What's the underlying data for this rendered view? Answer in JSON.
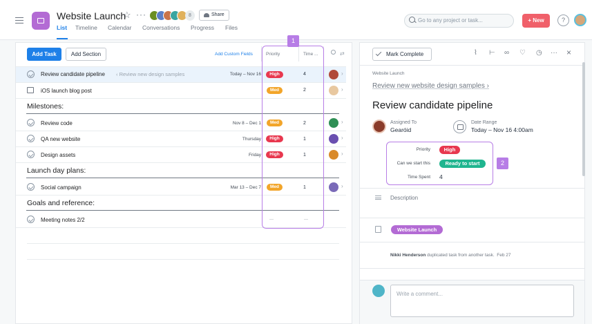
{
  "project": {
    "title": "Website Launch",
    "member_count": "8",
    "share_label": "Share",
    "icon": "project-list-icon",
    "brand_color": "#b36bd4"
  },
  "tabs": [
    "List",
    "Timeline",
    "Calendar",
    "Conversations",
    "Progress",
    "Files"
  ],
  "active_tab": "List",
  "search": {
    "placeholder": "Go to any project or task..."
  },
  "new_button": "+ New",
  "help_label": "?",
  "list": {
    "add_task": "Add Task",
    "add_section": "Add Section",
    "add_custom_fields": "Add Custom Fields",
    "columns": {
      "priority": "Priority",
      "time": "Time ..."
    },
    "tasks": [
      {
        "name": "Review candidate pipeline",
        "subtask_ref": "‹ Review new design samples",
        "date": "Today – Nov 16",
        "priority": "High",
        "time": "4",
        "selected": true
      },
      {
        "name": "iOS launch blog post",
        "date": "",
        "priority": "Med",
        "time": "2"
      }
    ],
    "sections": [
      {
        "title": "Milestones:",
        "tasks": [
          {
            "name": "Review code",
            "date": "Nov 8 – Dec 1",
            "priority": "Med",
            "time": "2"
          },
          {
            "name": "QA new website",
            "date": "Thursday",
            "priority": "High",
            "time": "1"
          },
          {
            "name": "Design assets",
            "date": "Friday",
            "priority": "High",
            "time": "1"
          }
        ]
      },
      {
        "title": "Launch day plans:",
        "tasks": [
          {
            "name": "Social campaign",
            "date": "Mar 13 – Dec 7",
            "priority": "Med",
            "time": "1"
          }
        ]
      },
      {
        "title": "Goals and reference:",
        "tasks": [
          {
            "name": "Meeting notes 2/2",
            "date": "",
            "priority": "---",
            "time": "---"
          }
        ]
      }
    ]
  },
  "annotations": {
    "box1": "1",
    "box2": "2"
  },
  "detail": {
    "mark_complete": "Mark Complete",
    "breadcrumb": "Website Launch",
    "parent_task": "Review new website design samples ›",
    "title": "Review candidate pipeline",
    "assigned_label": "Assigned To",
    "assigned_value": "Gearóid",
    "date_label": "Date Range",
    "date_value": "Today – Nov 16 4:00am",
    "fields": [
      {
        "label": "Priority",
        "value": "High",
        "color": "#e8384f"
      },
      {
        "label": "Can we start this",
        "value": "Ready to start",
        "color": "#1fb58f"
      },
      {
        "label": "Time Spent",
        "value": "4"
      }
    ],
    "description_label": "Description",
    "project_pill": "Website Launch",
    "story_author": "Nikki Henderson",
    "story_text": " duplicated task from another task.",
    "story_date": "Feb 27",
    "comment_placeholder": "Write a comment..."
  },
  "colors": {
    "accent": "#1e80e8",
    "high": "#e8384f",
    "med": "#f2a52a",
    "highlight": "#b77de6",
    "new_button": "#f0606a"
  }
}
